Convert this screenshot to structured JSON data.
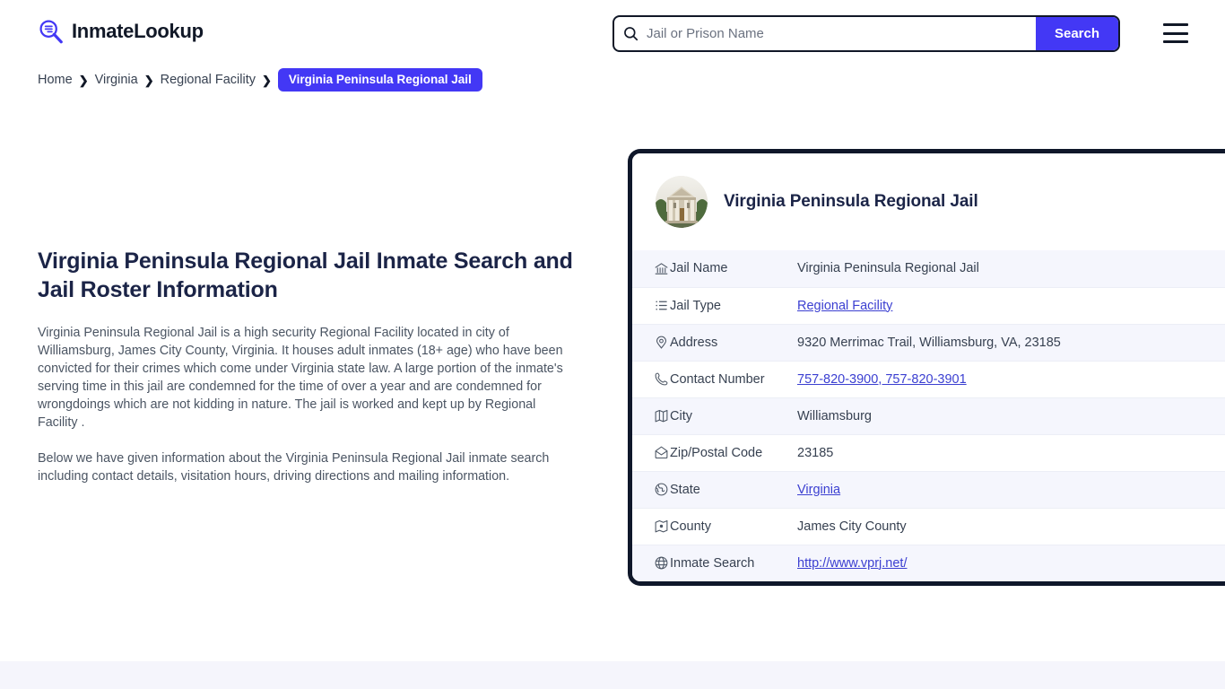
{
  "header": {
    "brand_name": "InmateLookup",
    "brand_icon": "magnifier-list-logo-icon",
    "menu_icon": "hamburger-menu-icon",
    "search": {
      "icon": "search-icon",
      "placeholder": "Jail or Prison Name",
      "value": "",
      "button_label": "Search",
      "button_color": "#4338f5"
    }
  },
  "breadcrumb": {
    "separator": "❯",
    "items": [
      {
        "label": "Home",
        "current": false
      },
      {
        "label": "Virginia",
        "current": false
      },
      {
        "label": "Regional Facility",
        "current": false
      },
      {
        "label": "Virginia Peninsula Regional Jail",
        "current": true
      }
    ]
  },
  "intro": {
    "heading": "Virginia Peninsula Regional Jail Inmate Search and Jail Roster Information",
    "paragraph_1": "Virginia Peninsula Regional Jail is a high security Regional Facility located in city of Williamsburg, James City County, Virginia. It houses adult inmates (18+ age) who have been convicted for their crimes which come under Virginia state law. A large portion of the inmate's serving time in this jail are condemned for the time of over a year and are condemned for wrongdoings which are not kidding in nature. The jail is worked and kept up by Regional Facility .",
    "paragraph_2": "Below we have given information about the Virginia Peninsula Regional Jail inmate search including contact details, visitation hours, driving directions and mailing information."
  },
  "info_card": {
    "title": "Virginia Peninsula Regional Jail",
    "avatar_icon": "courthouse-building-photo",
    "border_color": "#0f172a",
    "rows": [
      {
        "icon": "bank-building-icon",
        "label": "Jail Name",
        "value": "Virginia Peninsula Regional Jail",
        "link": false
      },
      {
        "icon": "list-icon",
        "label": "Jail Type",
        "value": "Regional Facility",
        "link": true
      },
      {
        "icon": "map-pin-icon",
        "label": "Address",
        "value": "9320 Merrimac Trail, Williamsburg, VA, 23185",
        "link": false
      },
      {
        "icon": "phone-icon",
        "label": "Contact Number",
        "value": "757-820-3900, 757-820-3901",
        "link": true
      },
      {
        "icon": "map-icon",
        "label": "City",
        "value": "Williamsburg",
        "link": false
      },
      {
        "icon": "envelope-open-icon",
        "label": "Zip/Postal Code",
        "value": "23185",
        "link": false
      },
      {
        "icon": "globe-americas-icon",
        "label": "State",
        "value": "Virginia",
        "link": true
      },
      {
        "icon": "map-marker-square-icon",
        "label": "County",
        "value": "James City County",
        "link": false
      },
      {
        "icon": "globe-icon",
        "label": "Inmate Search",
        "value": "http://www.vprj.net/",
        "link": true
      }
    ]
  },
  "colors": {
    "accent": "#4338f5",
    "link": "#3b3fd1",
    "heading": "#1b2447",
    "body_text": "#4b5563",
    "row_alt_bg": "#f5f6fd",
    "footer_band": "#f5f5fc"
  }
}
